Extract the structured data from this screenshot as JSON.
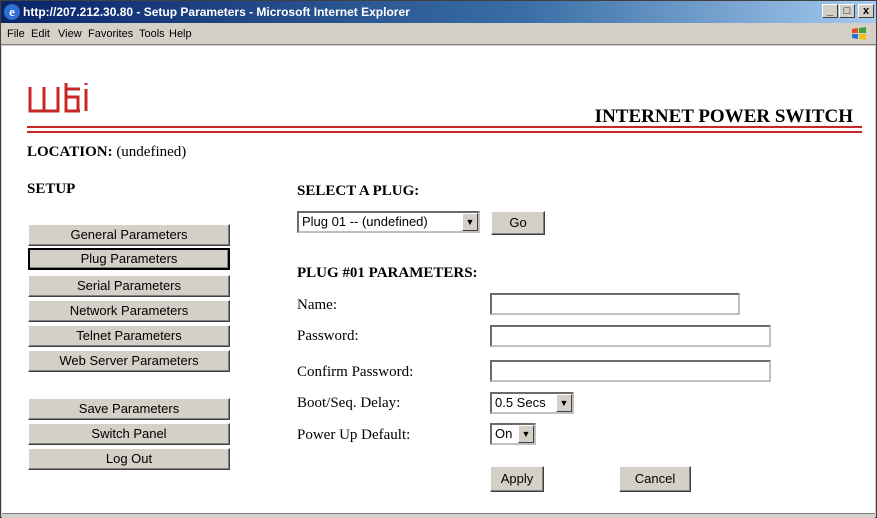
{
  "window": {
    "title": "http://207.212.30.80 - Setup Parameters - Microsoft Internet Explorer",
    "minimize": "_",
    "maximize": "□",
    "close": "x"
  },
  "menu": {
    "items": [
      "File",
      "Edit",
      "View",
      "Favorites",
      "Tools",
      "Help"
    ]
  },
  "header": {
    "logo_text": "wti",
    "product_name": "INTERNET POWER SWITCH",
    "accent_color": "#c62828"
  },
  "location": {
    "label": "LOCATION:",
    "value": "(undefined)"
  },
  "sidebar": {
    "heading": "SETUP",
    "items": [
      {
        "label": "General Parameters"
      },
      {
        "label": "Plug Parameters"
      },
      {
        "label": "Serial Parameters"
      },
      {
        "label": "Network Parameters"
      },
      {
        "label": "Telnet Parameters"
      },
      {
        "label": "Web Server Parameters"
      }
    ],
    "actions": [
      {
        "label": "Save Parameters"
      },
      {
        "label": "Switch Panel"
      },
      {
        "label": "Log Out"
      }
    ]
  },
  "plug_select": {
    "heading": "SELECT A PLUG:",
    "selected": "Plug 01 -- (undefined)",
    "go_label": "Go"
  },
  "plug_params": {
    "heading": "PLUG #01 PARAMETERS:",
    "name_label": "Name:",
    "name_value": "",
    "password_label": "Password:",
    "password_value": "",
    "confirm_label": "Confirm Password:",
    "confirm_value": "",
    "delay_label": "Boot/Seq. Delay:",
    "delay_value": "0.5 Secs",
    "power_label": "Power Up Default:",
    "power_value": "On",
    "apply_label": "Apply",
    "cancel_label": "Cancel"
  }
}
